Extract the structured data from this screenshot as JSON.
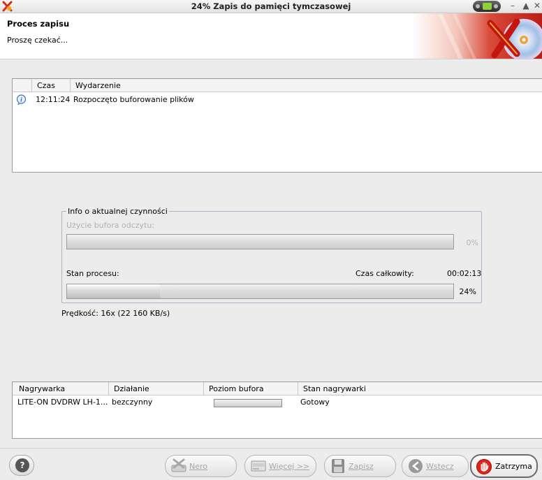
{
  "window": {
    "title": "24% Zapis do pamięci tymczasowej",
    "controls": [
      "–",
      "▲",
      "✕"
    ]
  },
  "header": {
    "title": "Proces zapisu",
    "subtitle": "Proszę czekać..."
  },
  "events": {
    "columns": [
      "Czas",
      "Wydarzenie"
    ],
    "rows": [
      {
        "icon": "info-icon",
        "time": "12:11:24",
        "event": "Rozpoczęto buforowanie plików"
      }
    ]
  },
  "info": {
    "legend": "Info o aktualnej czynności",
    "read_buffer_label": "Użycie bufora odczytu:",
    "read_buffer_percent_text": "0%",
    "read_buffer_fraction": 0,
    "process_label": "Stan procesu:",
    "total_time_label": "Czas całkowity:",
    "total_time": "00:02:13",
    "process_percent_text": "24%",
    "process_fraction": 0.24
  },
  "speed": "Prędkość: 16x (22 160 KB/s)",
  "recorders": {
    "columns": [
      "Nagrywarka",
      "Działanie",
      "Poziom bufora",
      "Stan nagrywarki"
    ],
    "rows": [
      {
        "name": "LITE-ON DVDRW LH-1...",
        "action": "bezczynny",
        "buffer_fraction": 0,
        "status": "Gotowy"
      }
    ]
  },
  "buttons": {
    "nero": "Nero",
    "more": "Więcej >>",
    "save": "Zapisz",
    "back": "Wstecz",
    "stop": "Zatrzyma"
  },
  "colors": {
    "accent_red": "#d42a1f",
    "stop_red": "#e02418",
    "group_border": "#a8b6c8"
  }
}
